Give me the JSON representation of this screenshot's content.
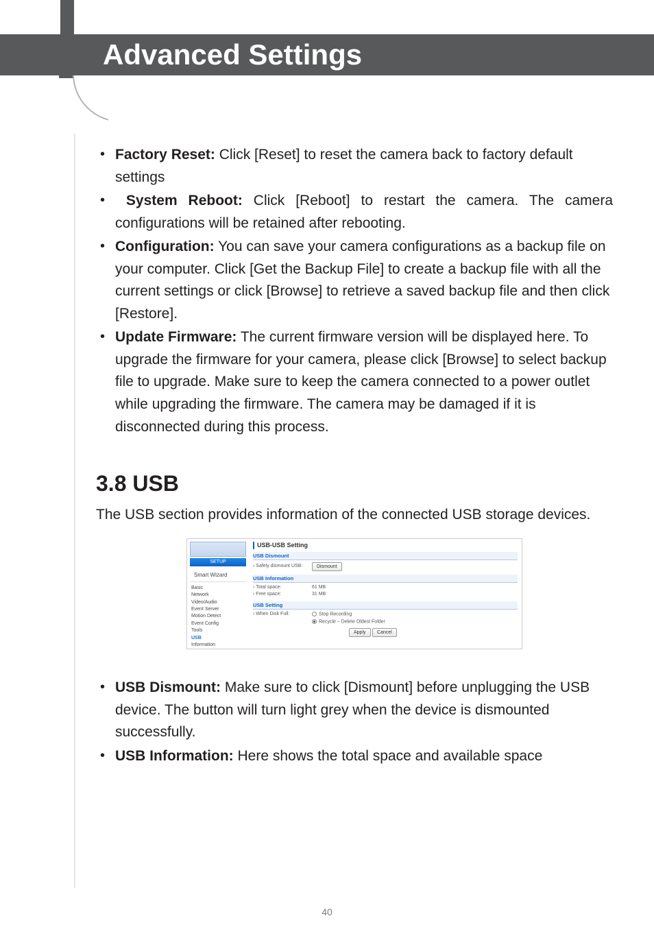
{
  "header": {
    "title": "Advanced Settings"
  },
  "bullets_top": [
    {
      "label": "Factory Reset:",
      "text": " Click [Reset] to reset the camera back to factory default settings"
    },
    {
      "label": "System Reboot:",
      "text": " Click [Reboot] to restart the camera. The camera configurations will be retained after rebooting."
    },
    {
      "label": "Configuration:",
      "text": " You can save your camera configurations as a backup file on your computer. Click [Get the Backup File] to create a backup file with all the current settings or click [Browse] to retrieve a saved backup file and then click [Restore]."
    },
    {
      "label": "Update Firmware:",
      "text": " The current firmware version will be displayed here. To upgrade the firmware for your camera, please click [Browse] to select backup file to upgrade.  Make sure to keep the camera connected to a power outlet while upgrading the firmware. The camera may be damaged if it is disconnected during this process."
    }
  ],
  "section": {
    "title": "3.8 USB",
    "intro": "The USB section provides information of the connected USB storage devices."
  },
  "screenshot": {
    "setup_label": "SETUP",
    "smart_wizard": "Smart Wizard",
    "nav": [
      "Basic",
      "Network",
      "Video/Audio",
      "Event Server",
      "Motion Detect",
      "Event Config",
      "Tools",
      "USB",
      "Information"
    ],
    "nav_selected": "USB",
    "title": "USB-USB Setting",
    "panels": {
      "dismount": {
        "head": "USB Dismount",
        "row_label": "› Safely dismount USB:",
        "button": "Dismount"
      },
      "info": {
        "head": "USB Information",
        "total_label": "› Total space:",
        "total_value": "61 MB",
        "free_label": "› Free space:",
        "free_value": "31 MB"
      },
      "setting": {
        "head": "USB Setting",
        "row_label": "› When Disk Full:",
        "opt_stop": "Stop Recording",
        "opt_recycle": "Recycle – Delete Oldest Folder",
        "apply": "Apply",
        "cancel": "Cancel"
      }
    }
  },
  "bullets_bottom": [
    {
      "label": "USB Dismount:",
      "text": " Make sure to click [Dismount] before unplugging the USB device. The button will turn light grey when the device is dismounted successfully."
    },
    {
      "label": "USB Information:",
      "text": " Here shows the total space and available space"
    }
  ],
  "page_number": "40"
}
